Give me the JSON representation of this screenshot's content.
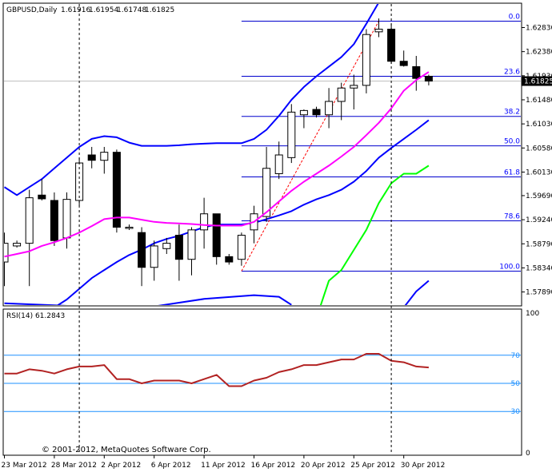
{
  "chart_data": {
    "type": "candlestick",
    "header": {
      "symbol": "GBPUSD,Daily",
      "open": "1.61916",
      "high": "1.61954",
      "low": "1.61748",
      "close": "1.61825"
    },
    "price_axis": {
      "ylim": [
        1.5766,
        1.6327
      ],
      "ticks": [
        "1.62830",
        "1.62380",
        "1.61930",
        "1.61480",
        "1.61030",
        "1.60580",
        "1.60130",
        "1.59690",
        "1.59240",
        "1.58790",
        "1.58340",
        "1.57890"
      ],
      "current_price_label": "1.61825"
    },
    "date_labels": [
      {
        "label": "23 Mar 2012",
        "bar": 0
      },
      {
        "label": "28 Mar 2012",
        "bar": 4
      },
      {
        "label": "2 Apr 2012",
        "bar": 8
      },
      {
        "label": "6 Apr 2012",
        "bar": 12
      },
      {
        "label": "11 Apr 2012",
        "bar": 16
      },
      {
        "label": "16 Apr 2012",
        "bar": 20
      },
      {
        "label": "20 Apr 2012",
        "bar": 24
      },
      {
        "label": "25 Apr 2012",
        "bar": 28
      },
      {
        "label": "30 Apr 2012",
        "bar": 32
      }
    ],
    "candles": [
      {
        "o": 1.5845,
        "h": 1.59,
        "l": 1.58,
        "c": 1.588
      },
      {
        "o": 1.5875,
        "h": 1.5885,
        "l": 1.5872,
        "c": 1.588
      },
      {
        "o": 1.588,
        "h": 1.598,
        "l": 1.58,
        "c": 1.5965
      },
      {
        "o": 1.597,
        "h": 1.6,
        "l": 1.596,
        "c": 1.5963
      },
      {
        "o": 1.596,
        "h": 1.5975,
        "l": 1.5875,
        "c": 1.5885
      },
      {
        "o": 1.589,
        "h": 1.5975,
        "l": 1.587,
        "c": 1.5962
      },
      {
        "o": 1.596,
        "h": 1.604,
        "l": 1.595,
        "c": 1.603
      },
      {
        "o": 1.6045,
        "h": 1.606,
        "l": 1.602,
        "c": 1.6035
      },
      {
        "o": 1.6035,
        "h": 1.606,
        "l": 1.601,
        "c": 1.605
      },
      {
        "o": 1.605,
        "h": 1.6055,
        "l": 1.59,
        "c": 1.591
      },
      {
        "o": 1.591,
        "h": 1.5915,
        "l": 1.5905,
        "c": 1.591
      },
      {
        "o": 1.59,
        "h": 1.591,
        "l": 1.58,
        "c": 1.5835
      },
      {
        "o": 1.5835,
        "h": 1.5885,
        "l": 1.581,
        "c": 1.5875
      },
      {
        "o": 1.587,
        "h": 1.589,
        "l": 1.586,
        "c": 1.588
      },
      {
        "o": 1.5895,
        "h": 1.5915,
        "l": 1.581,
        "c": 1.585
      },
      {
        "o": 1.585,
        "h": 1.591,
        "l": 1.582,
        "c": 1.5905
      },
      {
        "o": 1.5905,
        "h": 1.5965,
        "l": 1.587,
        "c": 1.5935
      },
      {
        "o": 1.5935,
        "h": 1.5935,
        "l": 1.584,
        "c": 1.5855
      },
      {
        "o": 1.5855,
        "h": 1.586,
        "l": 1.584,
        "c": 1.5845
      },
      {
        "o": 1.585,
        "h": 1.59,
        "l": 1.5838,
        "c": 1.5895
      },
      {
        "o": 1.5905,
        "h": 1.595,
        "l": 1.588,
        "c": 1.5935
      },
      {
        "o": 1.593,
        "h": 1.606,
        "l": 1.592,
        "c": 1.602
      },
      {
        "o": 1.601,
        "h": 1.607,
        "l": 1.6,
        "c": 1.6045
      },
      {
        "o": 1.604,
        "h": 1.614,
        "l": 1.603,
        "c": 1.6125
      },
      {
        "o": 1.612,
        "h": 1.613,
        "l": 1.6095,
        "c": 1.6128
      },
      {
        "o": 1.613,
        "h": 1.6135,
        "l": 1.6115,
        "c": 1.612
      },
      {
        "o": 1.612,
        "h": 1.617,
        "l": 1.6095,
        "c": 1.6145
      },
      {
        "o": 1.6145,
        "h": 1.618,
        "l": 1.611,
        "c": 1.617
      },
      {
        "o": 1.617,
        "h": 1.6195,
        "l": 1.613,
        "c": 1.6175
      },
      {
        "o": 1.6175,
        "h": 1.628,
        "l": 1.616,
        "c": 1.627
      },
      {
        "o": 1.6275,
        "h": 1.63,
        "l": 1.6265,
        "c": 1.628
      },
      {
        "o": 1.628,
        "h": 1.629,
        "l": 1.6215,
        "c": 1.622
      },
      {
        "o": 1.622,
        "h": 1.624,
        "l": 1.621,
        "c": 1.6212
      },
      {
        "o": 1.621,
        "h": 1.623,
        "l": 1.6165,
        "c": 1.6188
      },
      {
        "o": 1.6192,
        "h": 1.6195,
        "l": 1.6175,
        "c": 1.6183
      }
    ],
    "bollinger": {
      "upper": [
        1.5985,
        1.597,
        1.5985,
        1.6,
        1.602,
        1.604,
        1.606,
        1.6075,
        1.608,
        1.6078,
        1.6068,
        1.6062,
        1.6062,
        1.6062,
        1.6063,
        1.6065,
        1.6066,
        1.6067,
        1.6067,
        1.6067,
        1.6075,
        1.6092,
        1.6118,
        1.6148,
        1.6172,
        1.6192,
        1.621,
        1.6228,
        1.6252,
        1.629,
        1.633,
        1.635,
        1.636,
        1.636,
        1.636
      ],
      "middle": [
        1.5855,
        1.586,
        1.5865,
        1.5875,
        1.5882,
        1.589,
        1.59,
        1.5912,
        1.5925,
        1.5928,
        1.5928,
        1.5924,
        1.592,
        1.5918,
        1.5917,
        1.5916,
        1.5914,
        1.5913,
        1.5913,
        1.5913,
        1.592,
        1.5938,
        1.5958,
        1.5978,
        1.5995,
        1.601,
        1.6025,
        1.6042,
        1.606,
        1.6082,
        1.6105,
        1.6132,
        1.6165,
        1.6185,
        1.62
      ],
      "lower": [
        1.574,
        1.5745,
        1.5745,
        1.575,
        1.576,
        1.5775,
        1.5795,
        1.5815,
        1.583,
        1.5845,
        1.5858,
        1.5868,
        1.588,
        1.5888,
        1.5894,
        1.5902,
        1.591,
        1.5915,
        1.5915,
        1.5915,
        1.5918,
        1.5925,
        1.5932,
        1.594,
        1.5952,
        1.5962,
        1.597,
        1.598,
        1.5995,
        1.6015,
        1.604,
        1.6058,
        1.6075,
        1.6092,
        1.611
      ]
    },
    "lower_band_low_offscreen_points": [
      [
        0,
        1.5768
      ],
      [
        4,
        1.5764
      ],
      [
        8,
        1.576
      ],
      [
        12,
        1.5762
      ],
      [
        16,
        1.5776
      ],
      [
        20,
        1.5783
      ],
      [
        22,
        1.578
      ],
      [
        23,
        1.5765
      ]
    ],
    "green_line": [
      [
        25,
        1.574
      ],
      [
        26,
        1.581
      ],
      [
        27,
        1.583
      ],
      [
        29,
        1.5905
      ],
      [
        30,
        1.5955
      ],
      [
        31,
        1.5992
      ],
      [
        32,
        1.601
      ],
      [
        33,
        1.601
      ],
      [
        34,
        1.6025
      ]
    ],
    "blue_late_line": [
      [
        32,
        1.576
      ],
      [
        33,
        1.579
      ],
      [
        34,
        1.581
      ]
    ],
    "fibonacci": {
      "levels": [
        {
          "label": "0.0",
          "price": 1.6295
        },
        {
          "label": "23.6",
          "price": 1.6192
        },
        {
          "label": "38.2",
          "price": 1.6117
        },
        {
          "label": "50.0",
          "price": 1.6062
        },
        {
          "label": "61.8",
          "price": 1.6004
        },
        {
          "label": "78.6",
          "price": 1.5922
        },
        {
          "label": "100.0",
          "price": 1.5828
        }
      ],
      "start_bar": 19,
      "trendline": {
        "from_bar": 19,
        "from": 1.5828,
        "to_bar": 30,
        "to": 1.6295
      }
    },
    "vertical_markers": [
      6,
      31
    ],
    "copyright": "© 2001-2012, MetaQuotes Software Corp.",
    "rsi": {
      "label": "RSI(14) 61.2843",
      "ylim": [
        0,
        100
      ],
      "axis_ticks": [
        "100",
        "0"
      ],
      "levels": [
        70,
        50,
        30
      ],
      "values": [
        57,
        57,
        60,
        59,
        57,
        60,
        62,
        62,
        63,
        53,
        53,
        50,
        52,
        52,
        52,
        50,
        53,
        56,
        48,
        48,
        52,
        54,
        58,
        60,
        63,
        63,
        65,
        67,
        67,
        71,
        71,
        66,
        65,
        62,
        61.28
      ]
    },
    "colors": {
      "candle_outline": "#000000",
      "bull_fill": "#ffffff",
      "bear_fill": "#000000",
      "bollinger_outer": "#0000ff",
      "bollinger_mid": "#ff00ff",
      "green_line": "#00ff00",
      "fib_line": "#0000cd",
      "fib_text": "#0000ff",
      "trendline": "#ff0000",
      "rsi_line": "#b22222",
      "rsi_level": "#1e90ff"
    }
  }
}
